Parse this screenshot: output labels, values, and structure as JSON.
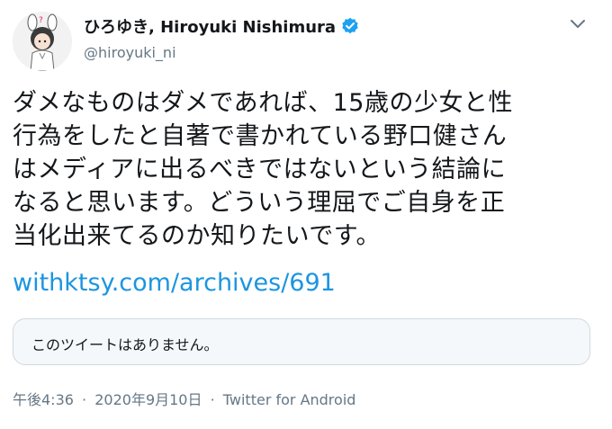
{
  "author": {
    "display_name": "ひろゆき, Hiroyuki Nishimura",
    "handle": "@hiroyuki_ni",
    "verified": true
  },
  "tweet": {
    "lines": [
      "ダメなものはダメであれば、15歳の少女と性",
      "行為をしたと自著で書かれている野口健さん",
      "はメディアに出るべきではないという結論に",
      "なると思います。どういう理屈でご自身を正",
      "当化出来てるのか知りたいです。"
    ],
    "link": "withktsy.com/archives/691"
  },
  "quoted_tweet": {
    "text": "このツイートはありません。"
  },
  "meta": {
    "time": "午後4:36",
    "date": "2020年9月10日",
    "source": "Twitter for Android",
    "separator": "·"
  },
  "colors": {
    "text": "#14171a",
    "secondary": "#657786",
    "link": "#1b95e0",
    "verified": "#1da1f2"
  },
  "icons": {
    "verified": "verified-badge-icon",
    "more": "chevron-down-icon",
    "avatar": "avatar-illustration"
  }
}
